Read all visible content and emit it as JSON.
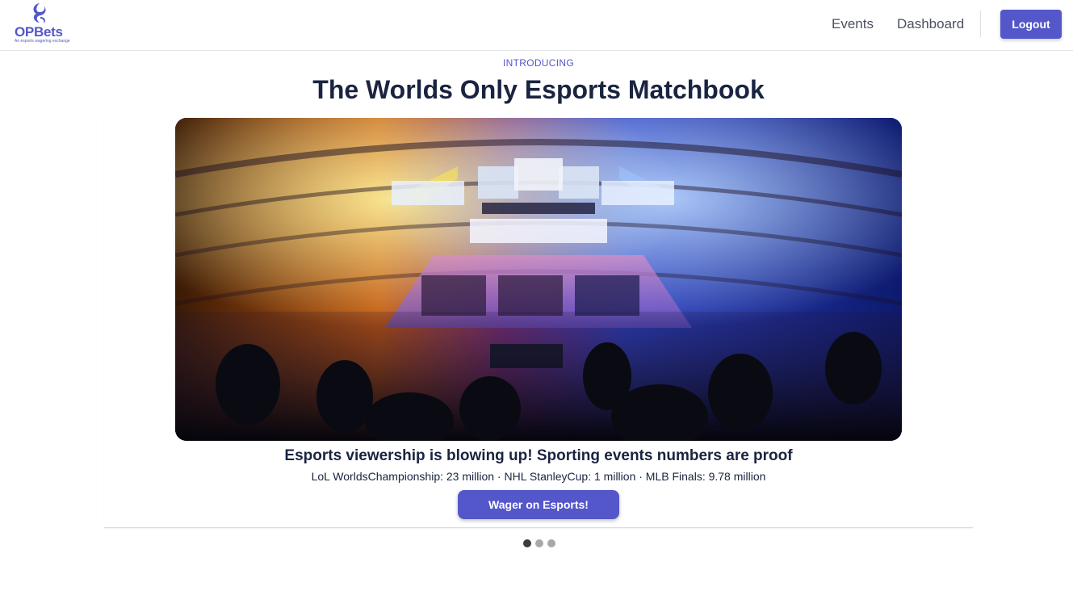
{
  "header": {
    "logo_text": "OPBets",
    "logo_tagline": "An esports wagering exchange",
    "nav": {
      "events_label": "Events",
      "dashboard_label": "Dashboard",
      "logout_label": "Logout"
    }
  },
  "intro": {
    "eyebrow": "INTRODUCING",
    "title": "The Worlds Only Esports Matchbook"
  },
  "carousel": {
    "active_slide": 1,
    "slide_count": 3,
    "slide": {
      "image_alt": "Esports arena crowd",
      "title": "Esports viewership is blowing up! Sporting events numbers are proof",
      "stats": "LoL WorldsChampionship: 23 million · NHL StanleyCup: 1 million · MLB Finals: 9.78 million",
      "cta_label": "Wager on Esports!"
    }
  },
  "colors": {
    "brand": "#5457c9",
    "heading": "#1a2440"
  },
  "icons": {
    "logo": "fish-swirl-logo-icon"
  }
}
